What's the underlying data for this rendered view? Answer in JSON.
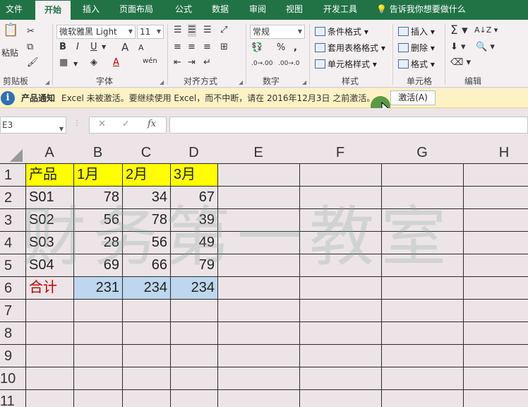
{
  "tabs": [
    "文件",
    "开始",
    "插入",
    "页面布局",
    "公式",
    "数据",
    "审阅",
    "视图",
    "开发工具"
  ],
  "active_tab": "开始",
  "tell_me": "告诉我你想要做什么",
  "ribbon": {
    "clipboard": {
      "paste_label": "粘贴",
      "group_label": "剪贴板"
    },
    "font": {
      "name": "微软雅黑 Light",
      "size": "11",
      "group_label": "字体",
      "bold": "B",
      "italic": "I",
      "underline": "U",
      "grow": "A",
      "shrink": "A",
      "phonetic": "wén"
    },
    "alignment": {
      "group_label": "对齐方式"
    },
    "number": {
      "format": "常规",
      "percent": "%",
      "comma": ",",
      "group_label": "数字"
    },
    "styles": {
      "conditional": "条件格式",
      "table": "套用表格格式",
      "cell": "单元格样式",
      "group_label": "样式"
    },
    "cells": {
      "insert": "插入",
      "delete": "删除",
      "format": "格式",
      "group_label": "单元格"
    },
    "editing": {
      "group_label": "编辑"
    }
  },
  "message_bar": {
    "title": "产品通知",
    "text": "Excel 未被激活。要继续使用 Excel，而不中断，请在 2016年12月3日 之前激活。",
    "button": "激活(A)"
  },
  "formula_bar": {
    "name_box": "E3",
    "fx": "fx",
    "cancel": "✕",
    "enter": "✓",
    "value": ""
  },
  "sheet": {
    "columns": [
      "A",
      "B",
      "C",
      "D",
      "E",
      "F",
      "G",
      "H"
    ],
    "rows": [
      "1",
      "2",
      "3",
      "4",
      "5",
      "6",
      "7",
      "8",
      "9",
      "10",
      "11"
    ],
    "header_row": [
      "产品",
      "1月",
      "2月",
      "3月"
    ],
    "data": [
      [
        "S01",
        "78",
        "34",
        "67"
      ],
      [
        "S02",
        "56",
        "78",
        "39"
      ],
      [
        "S03",
        "28",
        "56",
        "49"
      ],
      [
        "S04",
        "69",
        "66",
        "79"
      ]
    ],
    "total_row": [
      "合计",
      "231",
      "234",
      "234"
    ],
    "watermark": "财务第一教室"
  },
  "colors": {
    "ribbon_green": "#217346",
    "header_fill": "#ffff00",
    "total_fill": "#bdd7ee",
    "total_text": "#c00000"
  }
}
